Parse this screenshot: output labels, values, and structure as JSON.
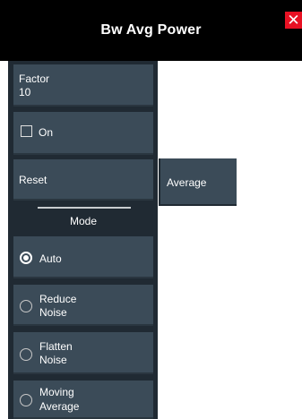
{
  "dialog": {
    "title": "Bw Avg Power",
    "close_label": "✕"
  },
  "factor": {
    "label": "Factor",
    "value": "10"
  },
  "on_checkbox": {
    "label": "On",
    "checked": false
  },
  "reset": {
    "label": "Reset"
  },
  "mode": {
    "heading": "Mode",
    "options": [
      {
        "label_lines": [
          "Auto"
        ],
        "selected": true
      },
      {
        "label_lines": [
          "Reduce",
          "Noise"
        ],
        "selected": false
      },
      {
        "label_lines": [
          "Flatten",
          "Noise"
        ],
        "selected": false
      },
      {
        "label_lines": [
          "Moving",
          "Average"
        ],
        "selected": false
      }
    ]
  },
  "submenu": {
    "average_label": "Average"
  },
  "colors": {
    "titlebar": "#000000",
    "panel": "#202a33",
    "button": "#3b4b58",
    "close": "#e81123",
    "text": "#ffffff"
  }
}
